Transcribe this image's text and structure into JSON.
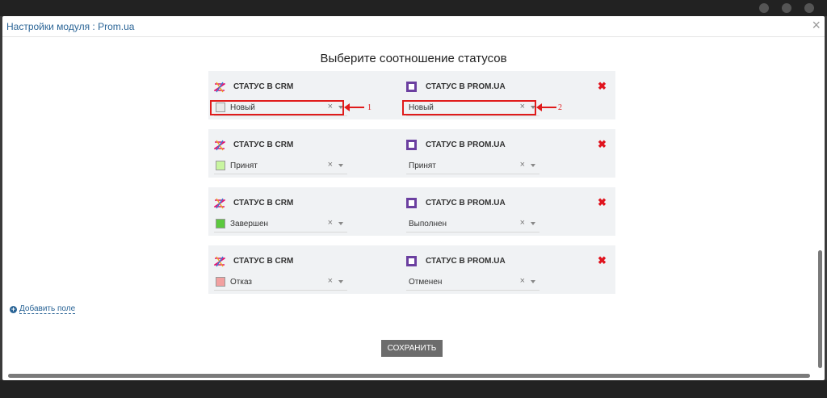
{
  "modal": {
    "title": "Настройки модуля : Prom.ua",
    "close_icon": "close-icon",
    "heading": "Выберите соотношение статусов",
    "crm_label": "СТАТУС В CRM",
    "prom_label": "СТАТУС В PROM.UA",
    "rules": [
      {
        "crm_status": "Новый",
        "crm_color": "#e8e8e8",
        "prom_status": "Новый"
      },
      {
        "crm_status": "Принят",
        "crm_color": "#c8f5a0",
        "prom_status": "Принят"
      },
      {
        "crm_status": "Завершен",
        "crm_color": "#5cc93e",
        "prom_status": "Выполнен"
      },
      {
        "crm_status": "Отказ",
        "crm_color": "#f2a0a0",
        "prom_status": "Отменен"
      }
    ],
    "clear_glyph": "×",
    "remove_glyph": "✖",
    "add_field": "Добавить поле",
    "save": "СОХРАНИТЬ"
  },
  "annotations": {
    "first": "1",
    "second": "2"
  },
  "colors": {
    "accent": "#2a6496",
    "remove": "#e0141e",
    "highlight": "#e01b1b",
    "prom_brand": "#6b3fa0"
  }
}
